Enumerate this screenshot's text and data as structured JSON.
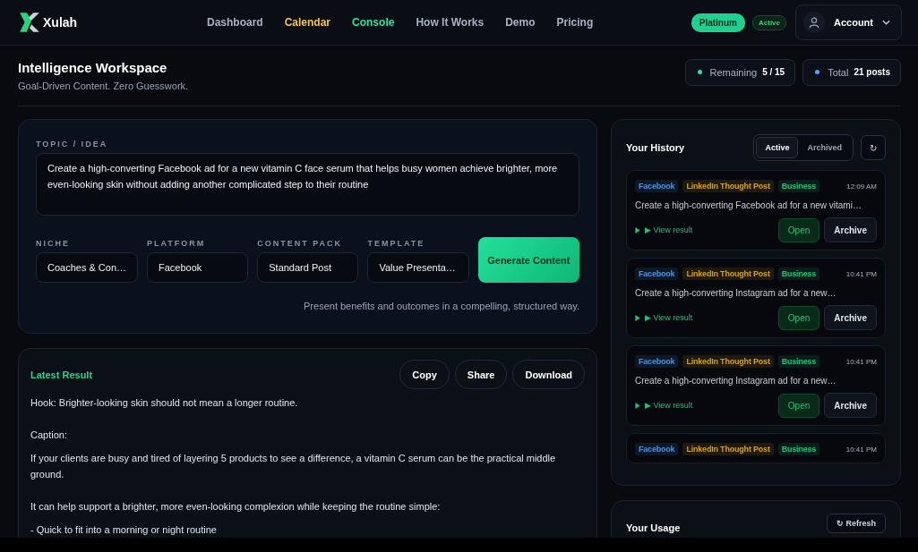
{
  "brand": {
    "name": "Xulah"
  },
  "nav": [
    {
      "label": "Dashboard",
      "color": "#a9b3c4"
    },
    {
      "label": "Calendar",
      "color": "#f5c451"
    },
    {
      "label": "Console",
      "color": "#34e0a1"
    },
    {
      "label": "How It Works",
      "color": "#a9b3c4"
    },
    {
      "label": "Demo",
      "color": "#a9b3c4"
    },
    {
      "label": "Pricing",
      "color": "#a9b3c4"
    }
  ],
  "plan": {
    "name": "Platinum",
    "status": "Active"
  },
  "account": {
    "label": "Account"
  },
  "page": {
    "title": "Intelligence Workspace",
    "subtitle": "Goal-Driven Content. Zero Guesswork."
  },
  "stats": [
    {
      "label": "Remaining",
      "value": "5 / 15",
      "color": "#34e0a1"
    },
    {
      "label": "Total",
      "value": "21 posts",
      "color": "#5aa0f0"
    }
  ],
  "composer": {
    "topic_label": "TOPIC / IDEA",
    "topic": "Create a high-converting Facebook ad for a new vitamin C face serum that helps busy women achieve brighter, more even-looking skin without adding another complicated step to their routine",
    "selects": [
      {
        "label": "NICHE",
        "value": "Coaches & Con…"
      },
      {
        "label": "PLATFORM",
        "value": "Facebook"
      },
      {
        "label": "CONTENT PACK",
        "value": "Standard Post"
      },
      {
        "label": "TEMPLATE",
        "value": "Value Presenta…"
      }
    ],
    "generate": "Generate Content",
    "hint": "Present benefits and outcomes in a compelling, structured way."
  },
  "result": {
    "title": "Latest Result",
    "actions": [
      "Copy",
      "Share",
      "Download"
    ],
    "paragraphs": [
      {
        "text": "Hook: Brighter-looking skin should not mean a longer routine.",
        "gap_after": true
      },
      {
        "text": "Caption:",
        "gap_after": false
      },
      {
        "text": "If your clients are busy and tired of layering 5 products to see a difference, a vitamin C serum can be the practical middle ground.",
        "gap_after": true
      },
      {
        "text": "It can help support a brighter, more even-looking complexion while keeping the routine simple:",
        "gap_after": false
      },
      {
        "text": "- Quick to fit into a morning or night routine",
        "gap_after": false
      }
    ]
  },
  "history": {
    "title": "Your History",
    "filters": [
      {
        "label": "Active",
        "selected": true
      },
      {
        "label": "Archived",
        "selected": false
      }
    ],
    "refresh_icon": "↻",
    "items": [
      {
        "tags": [
          {
            "label": "Facebook",
            "color": "#4a90e2"
          },
          {
            "label": "LinkedIn Thought Post",
            "color": "#d4a017"
          },
          {
            "label": "Business",
            "color": "#22c07a"
          }
        ],
        "time": "12:09 AM",
        "text": "Create a high-converting Facebook ad for a new vitami…",
        "view": "▶ View result",
        "open": "Open",
        "archive": "Archive"
      },
      {
        "tags": [
          {
            "label": "Facebook",
            "color": "#4a90e2"
          },
          {
            "label": "LinkedIn Thought Post",
            "color": "#d4a017"
          },
          {
            "label": "Business",
            "color": "#22c07a"
          }
        ],
        "time": "10:41 PM",
        "text": "Create a high-converting Instagram ad for a new…",
        "view": "▶ View result",
        "open": "Open",
        "archive": "Archive"
      },
      {
        "tags": [
          {
            "label": "Facebook",
            "color": "#4a90e2"
          },
          {
            "label": "LinkedIn Thought Post",
            "color": "#d4a017"
          },
          {
            "label": "Business",
            "color": "#22c07a"
          }
        ],
        "time": "10:41 PM",
        "text": "Create a high-converting Instagram ad for a new…",
        "view": "▶ View result",
        "open": "Open",
        "archive": "Archive"
      },
      {
        "tags": [
          {
            "label": "Facebook",
            "color": "#4a90e2"
          },
          {
            "label": "LinkedIn Thought Post",
            "color": "#d4a017"
          },
          {
            "label": "Business",
            "color": "#22c07a"
          }
        ],
        "time": "10:41 PM"
      }
    ]
  },
  "usage": {
    "title": "Your Usage",
    "refresh": "↻ Refresh"
  }
}
